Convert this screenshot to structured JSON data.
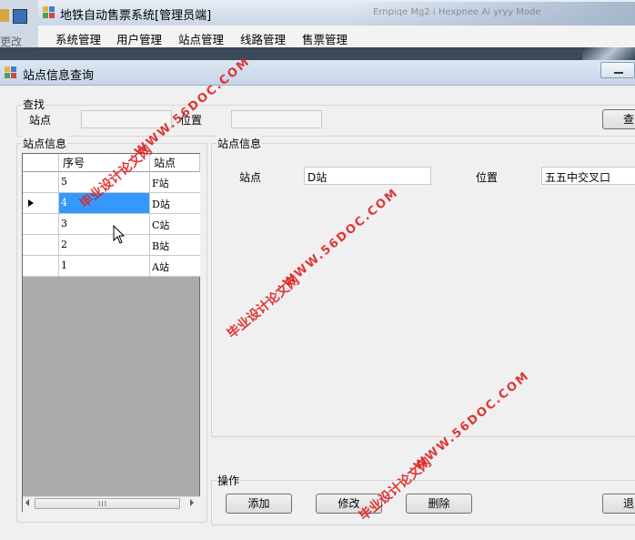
{
  "background_window": {
    "title": "地铁自动售票系统[管理员端]",
    "toolbar_fragment_left": "更改",
    "blurred_tab_text": "Ernpiqe Mg2 i Hexpnee Ai yryy Mode",
    "menu": [
      "系统管理",
      "用户管理",
      "站点管理",
      "线路管理",
      "售票管理"
    ]
  },
  "dialog": {
    "title": "站点信息查询",
    "search": {
      "group_title": "查找",
      "station_label": "站点",
      "station_value": "",
      "location_label": "位置",
      "location_value": "",
      "search_button": "查"
    },
    "list_group_title": "站点信息",
    "grid": {
      "columns": [
        "序号",
        "站点"
      ],
      "rows": [
        {
          "id": "5",
          "station": "F站",
          "selected": false,
          "current": false
        },
        {
          "id": "4",
          "station": "D站",
          "selected": true,
          "current": true
        },
        {
          "id": "3",
          "station": "C站",
          "selected": false,
          "current": false
        },
        {
          "id": "2",
          "station": "B站",
          "selected": false,
          "current": false
        },
        {
          "id": "1",
          "station": "A站",
          "selected": false,
          "current": false
        }
      ],
      "scroll_grip": "III"
    },
    "detail": {
      "group_title": "站点信息",
      "station_label": "站点",
      "station_value": "D站",
      "location_label": "位置",
      "location_value": "五五中交叉口"
    },
    "actions": {
      "group_title": "操作",
      "add": "添加",
      "edit": "修改",
      "delete": "删除",
      "exit": "退"
    }
  },
  "watermarks": [
    "毕业设计论文网",
    "WWW.56DOC.COM"
  ],
  "colors": {
    "selection": "#3399ff",
    "watermark": "#dd2222",
    "dialog_bg": "#f0f0f0",
    "grid_empty": "#ababab"
  }
}
